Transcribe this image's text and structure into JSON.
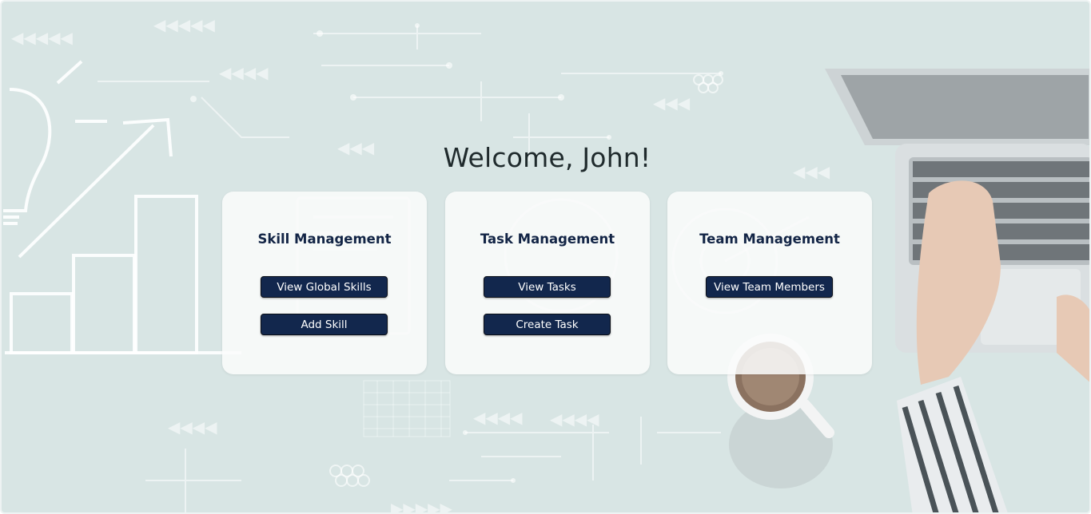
{
  "page": {
    "welcome": "Welcome, John!"
  },
  "cards": [
    {
      "title": "Skill Management",
      "buttons": [
        "View Global Skills",
        "Add Skill"
      ]
    },
    {
      "title": "Task Management",
      "buttons": [
        "View Tasks",
        "Create Task"
      ]
    },
    {
      "title": "Team Management",
      "buttons": [
        "View Team Members"
      ]
    }
  ],
  "colors": {
    "background": "#d8e5e4",
    "button": "#12274d",
    "card_title": "#132546",
    "welcome_text": "#1f2a2c"
  }
}
